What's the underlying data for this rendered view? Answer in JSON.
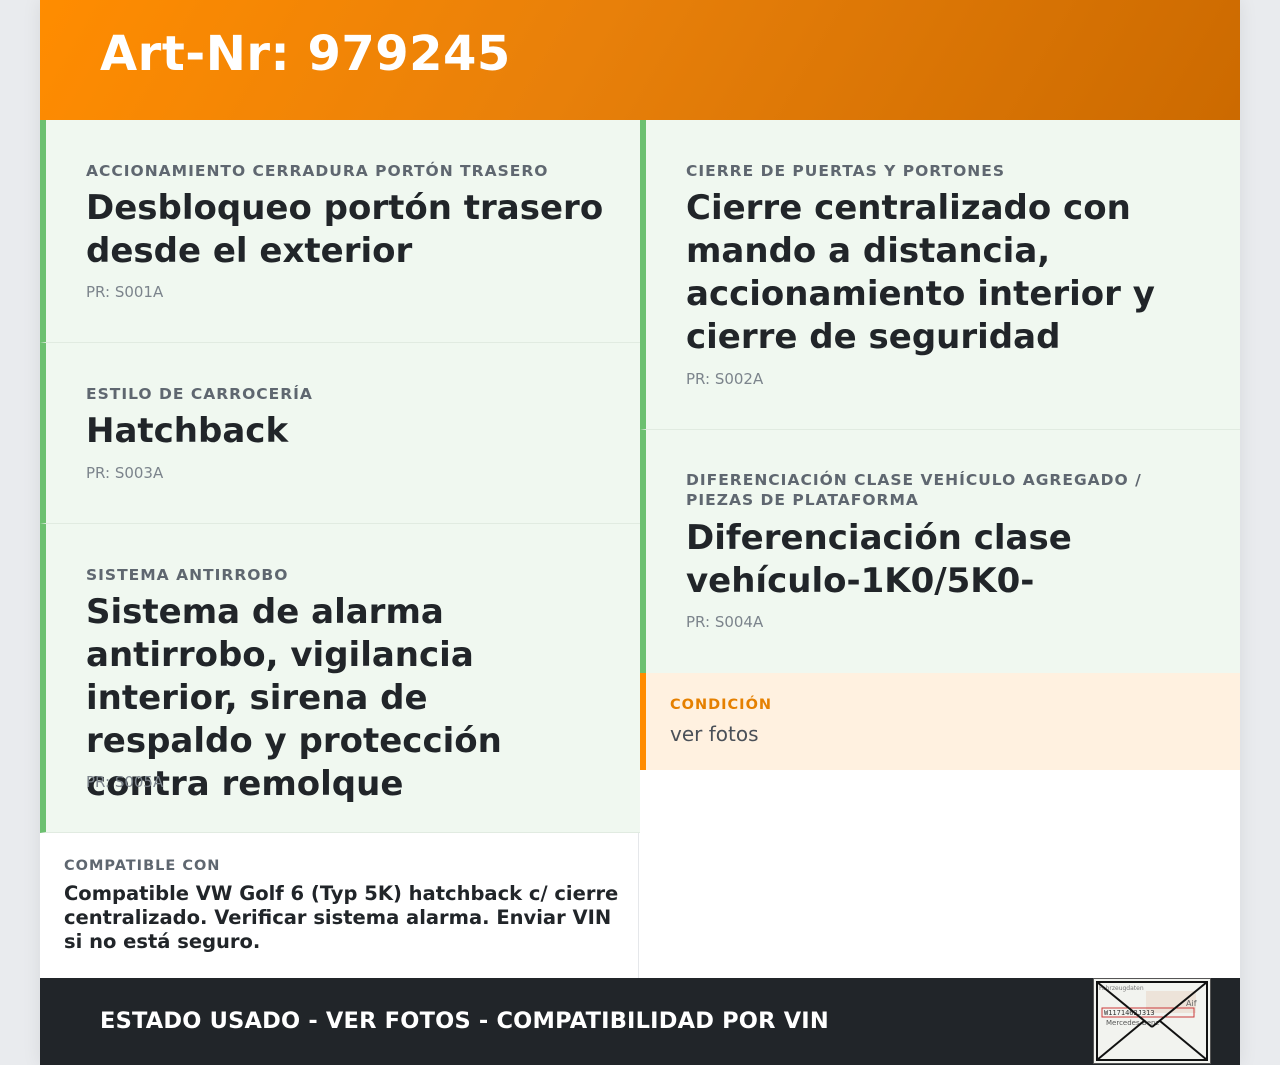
{
  "header": {
    "title": "Art-Nr: 979245"
  },
  "left_cards": [
    {
      "label": "ACCIONAMIENTO CERRADURA PORTÓN TRASERO",
      "value": "Desbloqueo portón trasero desde el exterior",
      "pr": "PR: S001A"
    },
    {
      "label": "ESTILO DE CARROCERÍA",
      "value": "Hatchback",
      "pr": "PR: S003A"
    },
    {
      "label": "SISTEMA ANTIRROBO",
      "value": "Sistema de alarma antirrobo, vigilancia interior, sirena de respaldo y protección contra remolque",
      "pr": "PR: S005A"
    }
  ],
  "right_cards": [
    {
      "label": "CIERRE DE PUERTAS Y PORTONES",
      "value": "Cierre centralizado con mando a distancia, accionamiento interior y cierre de seguridad",
      "pr": "PR: S002A"
    },
    {
      "label": "DIFERENCIACIÓN CLASE VEHÍCULO AGREGADO / PIEZAS DE PLATAFORMA",
      "value": "Diferenciación clase vehículo-1K0/5K0-",
      "pr": "PR: S004A"
    }
  ],
  "condition": {
    "label": "CONDICIÓN",
    "value": "ver fotos"
  },
  "compatible": {
    "label": "COMPATIBLE CON",
    "text": "Compatible VW Golf 6 (Typ 5K) hatchback c/ cierre centralizado. Verificar sistema alarma. Enviar VIN si no está seguro."
  },
  "footer": {
    "text": "ESTADO USADO - VER FOTOS - COMPATIBILIDAD POR VIN"
  },
  "thumbnail": {
    "icon": "envelope-icon",
    "line1_left": "Fahrzeugdaten",
    "line1_right": "Aif",
    "line2": "W1171462J313",
    "line3": "Mercedes-Benz"
  },
  "colors": {
    "accent": "#ff8c00",
    "card_bg": "#f0f8f0",
    "card_border": "#6cc070",
    "condition_bg": "#fff1e0",
    "footer_bg": "#212529"
  }
}
